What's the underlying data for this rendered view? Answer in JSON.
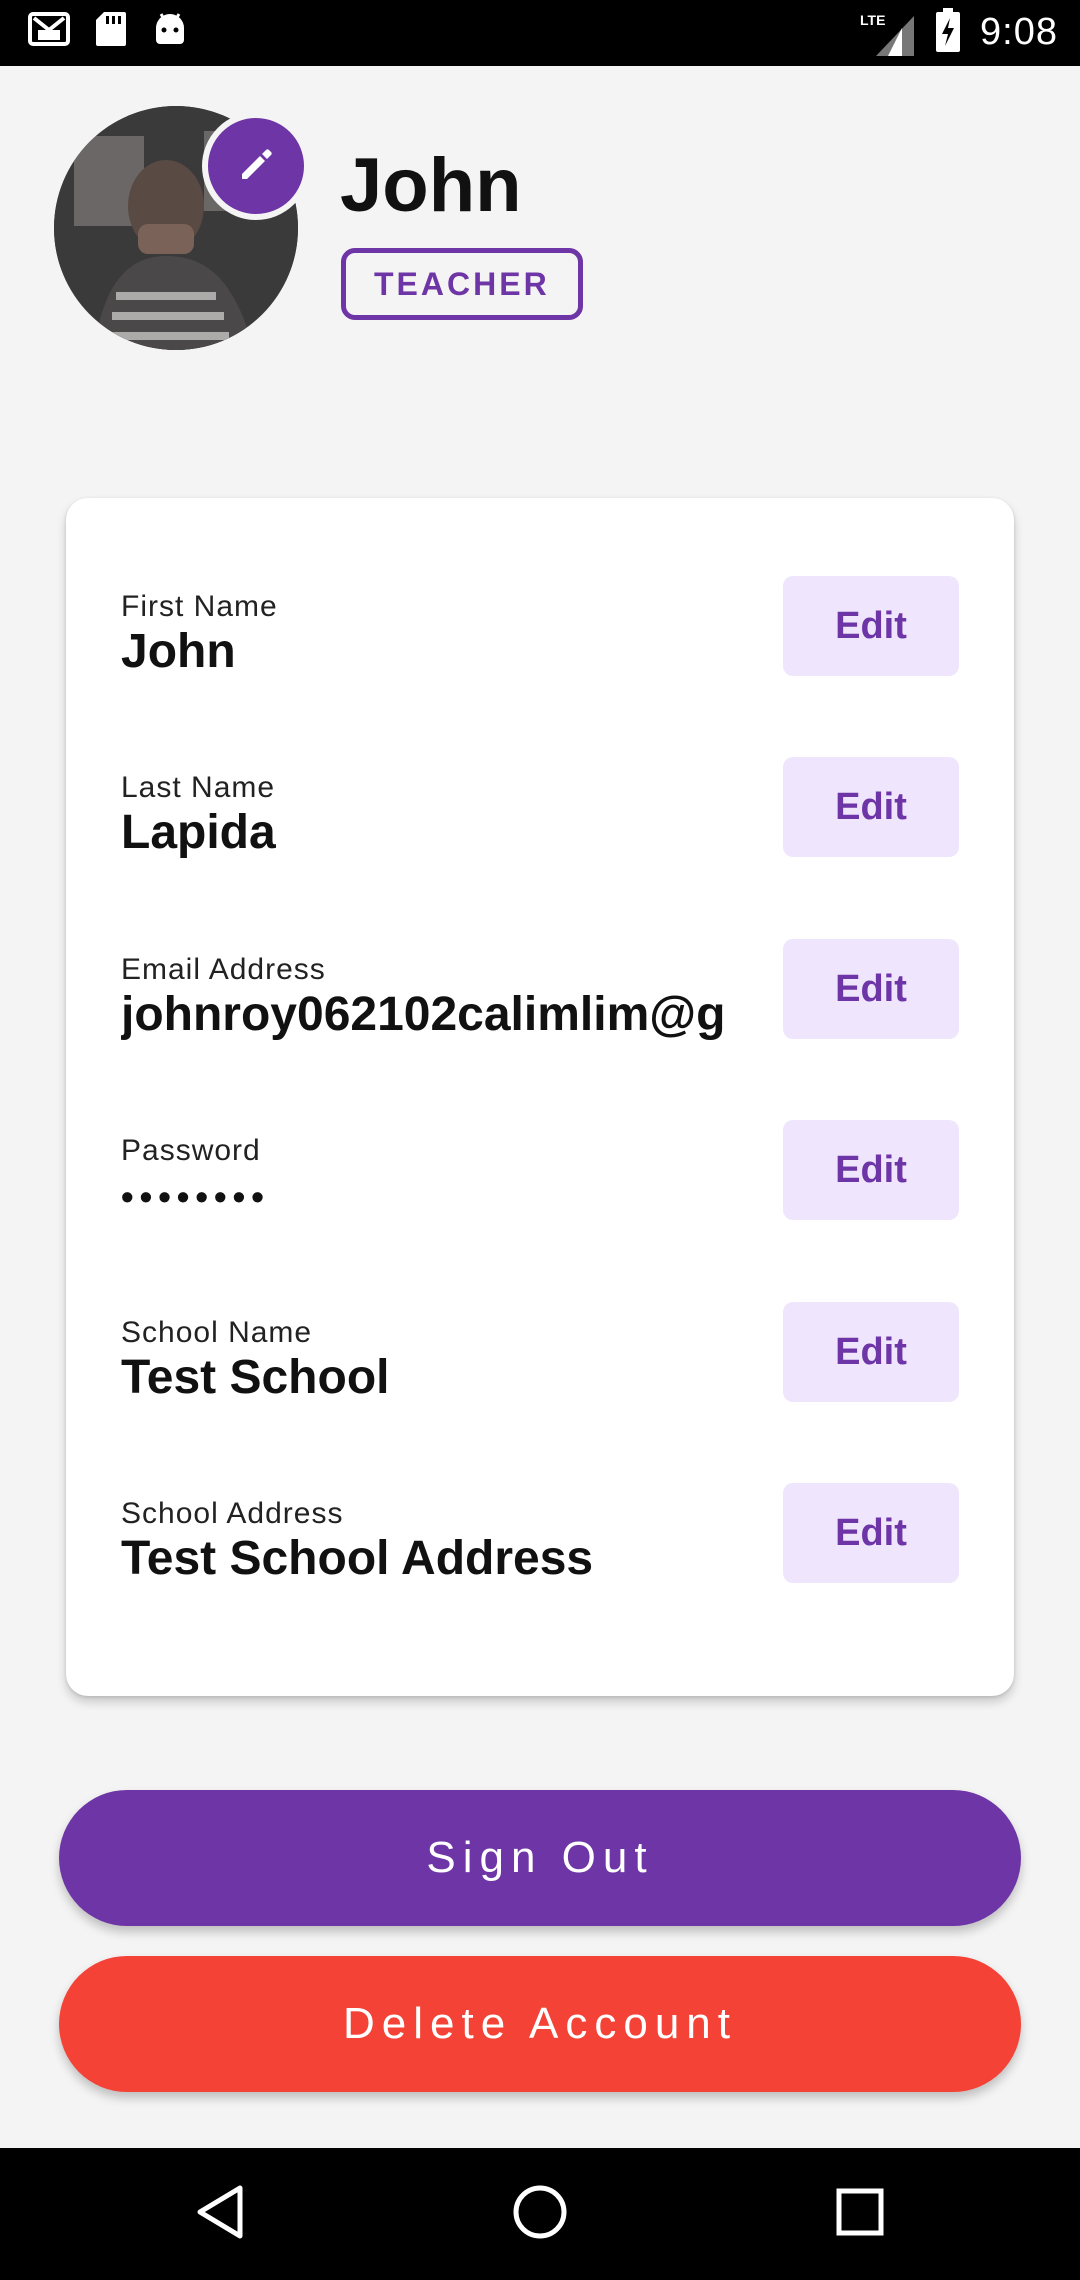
{
  "status_bar": {
    "time": "9:08",
    "network": "LTE",
    "left_icons": [
      "gmail-icon",
      "sd-card-icon",
      "android-icon"
    ],
    "right_icons": [
      "signal-icon",
      "battery-charging-icon"
    ]
  },
  "profile": {
    "name": "John",
    "role": "TEACHER",
    "avatar": "profile-photo",
    "edit_icon": "pencil-icon"
  },
  "fields": [
    {
      "label": "First Name",
      "value": "John",
      "edit_label": "Edit"
    },
    {
      "label": "Last Name",
      "value": "Lapida",
      "edit_label": "Edit"
    },
    {
      "label": "Email Address",
      "value": "johnroy062102calimlim@g",
      "edit_label": "Edit"
    },
    {
      "label": "Password",
      "value": "••••••••",
      "edit_label": "Edit"
    },
    {
      "label": "School Name",
      "value": "Test School",
      "edit_label": "Edit"
    },
    {
      "label": "School Address",
      "value": "Test School Address",
      "edit_label": "Edit"
    }
  ],
  "actions": {
    "sign_out_label": "Sign Out",
    "delete_label": "Delete Account"
  },
  "colors": {
    "accent": "#6e35a6",
    "danger": "#f44336",
    "edit_bg": "#efe6fd",
    "background": "#f4f4f4"
  },
  "nav_bar": {
    "icons": [
      "back-icon",
      "home-icon",
      "recents-icon"
    ]
  }
}
